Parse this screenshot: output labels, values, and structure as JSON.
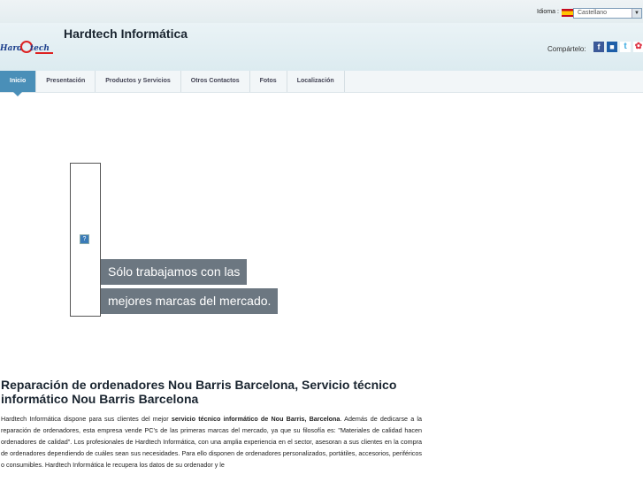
{
  "language": {
    "label": "Idioma :",
    "selected": "Castellano",
    "flag_colors": [
      "#c60b1e",
      "#ffc400"
    ]
  },
  "header": {
    "logo_text": "Hardtech",
    "title": "Hardtech Informática",
    "share_label": "Compártelo:",
    "share_icons": [
      "facebook-icon",
      "delicious-icon",
      "twitter-icon",
      "other-share-icon"
    ]
  },
  "nav": {
    "items": [
      {
        "label": "Inicio",
        "active": true
      },
      {
        "label": "Presentación"
      },
      {
        "label": "Productos y Servicios"
      },
      {
        "label": "Otros Contactos"
      },
      {
        "label": "Fotos"
      },
      {
        "label": "Localización"
      }
    ]
  },
  "slider": {
    "caption_line1": "Sólo trabajamos con las",
    "caption_line2": "mejores marcas del mercado."
  },
  "content": {
    "heading": "Reparación de ordenadores Nou Barris Barcelona, Servicio técnico informático Nou Barris Barcelona",
    "para_start": "Hardtech Informática dispone para sus clientes del mejor ",
    "para_bold": "servicio técnico informático de Nou Barris, Barcelona",
    "para_rest": ". Además de dedicarse a la reparación de ordenadores, esta empresa vende PC's de las primeras marcas del mercado, ya que su filosofía es: \"Materiales de calidad hacen ordenadores de calidad\". Los profesionales de Hardtech Informática, con una amplia experiencia en el sector, asesoran a sus clientes en la compra de ordenadores dependiendo de cuáles sean sus necesidades. Para ello disponen de ordenadores personalizados, portátiles, accesorios, periféricos o consumibles. Hardtech Informática le recupera los datos de su ordenador y le"
  },
  "colors": {
    "accent": "#4a8fb8",
    "caption_bg": "#64707a",
    "header_bg": "#dcebf0"
  }
}
